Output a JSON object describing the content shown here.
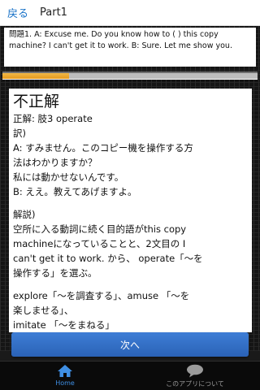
{
  "topbar": {
    "back_label": "戻る",
    "title": "Part1"
  },
  "question": {
    "text": "問題1. A: Excuse me. Do you know how to ( ) this copy machine? I can't get it to work. B: Sure. Let me show you."
  },
  "progress": {
    "fraction": 0.26
  },
  "answer": {
    "result": "不正解",
    "correct": "正解: 肢3 operate",
    "translation_heading": "訳)",
    "translation_lines": [
      "A: すみません。このコピー機を操作する方",
      "法はわかりますか？",
      "私には動かせないんです。",
      "B: ええ。教えてあげますよ。"
    ],
    "explanation_heading": "解説)",
    "explanation_lines": [
      "空所に入る動詞に続く目的語がthis copy",
      "machineになっていることと、2文目の I",
      "can't get it to work. から、 operate「～を",
      "操作する」を選ぶ。"
    ],
    "extra_lines": [
      "explore「～を調査する」、amuse 「～を",
      "楽しませる」、",
      "imitate 「～をまねる」"
    ]
  },
  "next_button": {
    "label": "次へ"
  },
  "bottom_nav": {
    "home_label": "Home",
    "about_label": "このアプリについて",
    "home_icon": "home-icon",
    "about_icon": "chat-bubble-icon"
  },
  "colors": {
    "accent": "#3f8fe4",
    "button": "#2f6fc8",
    "progress": "#e9a327"
  }
}
